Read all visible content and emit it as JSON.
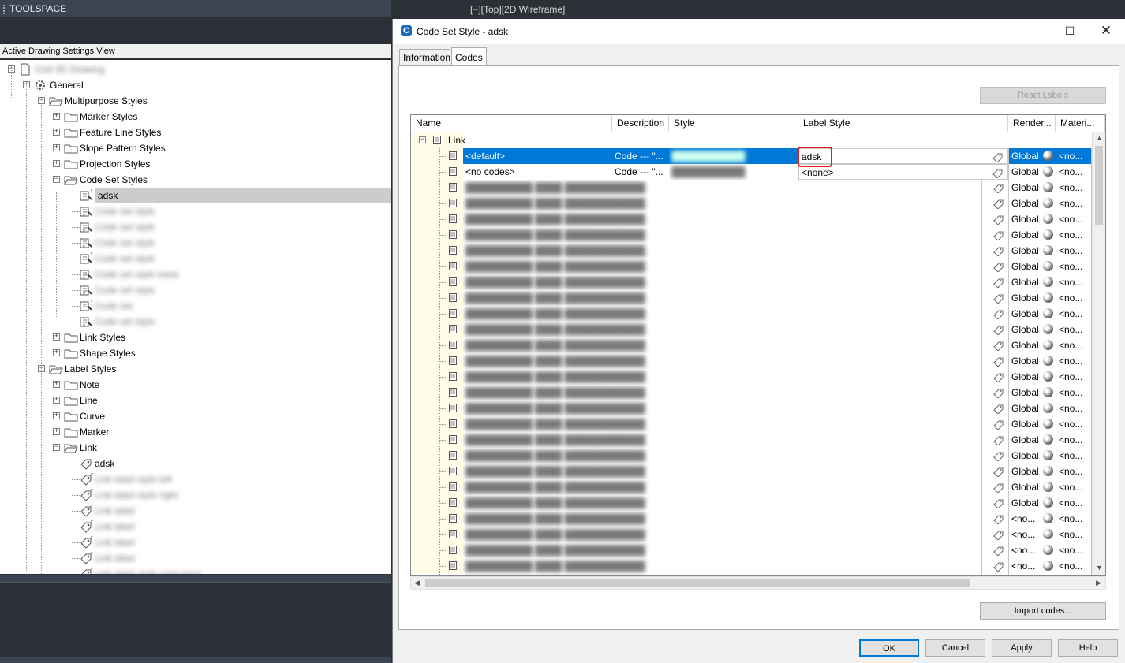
{
  "toolspace": {
    "title": "TOOLSPACE",
    "view_header": "Active Drawing Settings View",
    "tree": [
      {
        "label": "Civil 3D Drawing",
        "level": 0,
        "exp": "-",
        "icon": "drawing",
        "blur": true
      },
      {
        "label": "General",
        "level": 1,
        "exp": "-",
        "icon": "gear"
      },
      {
        "label": "Multipurpose Styles",
        "level": 2,
        "exp": "-",
        "icon": "folder-open"
      },
      {
        "label": "Marker Styles",
        "level": 3,
        "exp": "+",
        "icon": "folder"
      },
      {
        "label": "Feature Line Styles",
        "level": 3,
        "exp": "+",
        "icon": "folder"
      },
      {
        "label": "Slope Pattern Styles",
        "level": 3,
        "exp": "+",
        "icon": "folder"
      },
      {
        "label": "Projection Styles",
        "level": 3,
        "exp": "+",
        "icon": "folder"
      },
      {
        "label": "Code Set Styles",
        "level": 3,
        "exp": "-",
        "icon": "folder-open"
      },
      {
        "label": "adsk",
        "level": 4,
        "exp": "",
        "icon": "style-new",
        "selected": true
      },
      {
        "label": "Code set style",
        "level": 4,
        "exp": "",
        "icon": "style",
        "blur": true
      },
      {
        "label": "Code set style",
        "level": 4,
        "exp": "",
        "icon": "style",
        "blur": true
      },
      {
        "label": "Code set style",
        "level": 4,
        "exp": "",
        "icon": "style",
        "blur": true
      },
      {
        "label": "Code set style",
        "level": 4,
        "exp": "",
        "icon": "style-new",
        "blur": true
      },
      {
        "label": "Code set style extra",
        "level": 4,
        "exp": "",
        "icon": "style",
        "blur": true
      },
      {
        "label": "Code set style",
        "level": 4,
        "exp": "",
        "icon": "style",
        "blur": true
      },
      {
        "label": "Code set",
        "level": 4,
        "exp": "",
        "icon": "style-new",
        "blur": true
      },
      {
        "label": "Code set style",
        "level": 4,
        "exp": "",
        "icon": "style",
        "blur": true
      },
      {
        "label": "Link Styles",
        "level": 3,
        "exp": "+",
        "icon": "folder"
      },
      {
        "label": "Shape Styles",
        "level": 3,
        "exp": "+",
        "icon": "folder"
      },
      {
        "label": "Label Styles",
        "level": 2,
        "exp": "-",
        "icon": "folder-open"
      },
      {
        "label": "Note",
        "level": 3,
        "exp": "+",
        "icon": "folder"
      },
      {
        "label": "Line",
        "level": 3,
        "exp": "+",
        "icon": "folder"
      },
      {
        "label": "Curve",
        "level": 3,
        "exp": "+",
        "icon": "folder"
      },
      {
        "label": "Marker",
        "level": 3,
        "exp": "+",
        "icon": "folder"
      },
      {
        "label": "Link",
        "level": 3,
        "exp": "-",
        "icon": "folder-open"
      },
      {
        "label": "adsk",
        "level": 4,
        "exp": "",
        "icon": "label"
      },
      {
        "label": "Link label style left",
        "level": 4,
        "exp": "",
        "icon": "label-new",
        "blur": true
      },
      {
        "label": "Link label style right",
        "level": 4,
        "exp": "",
        "icon": "label-new",
        "blur": true
      },
      {
        "label": "Link label",
        "level": 4,
        "exp": "",
        "icon": "label-new",
        "blur": true
      },
      {
        "label": "Link label",
        "level": 4,
        "exp": "",
        "icon": "label-new",
        "blur": true
      },
      {
        "label": "Link label",
        "level": 4,
        "exp": "",
        "icon": "label-new",
        "blur": true
      },
      {
        "label": "Link label",
        "level": 4,
        "exp": "",
        "icon": "label-new",
        "blur": true
      },
      {
        "label": "Link label style extra long",
        "level": 4,
        "exp": "",
        "icon": "label-new",
        "blur": true
      }
    ]
  },
  "viewport": {
    "label": "[−][Top][2D Wireframe]"
  },
  "dialog": {
    "title": "Code Set Style - adsk",
    "tabs": [
      {
        "label": "Information",
        "active": false
      },
      {
        "label": "Codes",
        "active": true
      }
    ],
    "reset_labels": "Reset Labels",
    "import_codes": "Import codes...",
    "buttons": {
      "ok": "OK",
      "cancel": "Cancel",
      "apply": "Apply",
      "help": "Help"
    },
    "columns": [
      "Name",
      "Description",
      "Style",
      "Label Style",
      "Render...",
      "Materi..."
    ],
    "group_label": "Link",
    "rows": [
      {
        "name": "<default>",
        "desc": "Code --- \"...",
        "label_style": "adsk",
        "render": "Global",
        "material": "<no...",
        "selected": true
      },
      {
        "name": "<no codes>",
        "desc": "Code --- \"...",
        "label_style": "<none>",
        "render": "Global",
        "material": "<no..."
      }
    ],
    "blurred_rows": [
      {
        "render": "Global",
        "material": "<no..."
      },
      {
        "render": "Global",
        "material": "<no..."
      },
      {
        "render": "Global",
        "material": "<no..."
      },
      {
        "render": "Global",
        "material": "<no..."
      },
      {
        "render": "Global",
        "material": "<no..."
      },
      {
        "render": "Global",
        "material": "<no..."
      },
      {
        "render": "Global",
        "material": "<no..."
      },
      {
        "render": "Global",
        "material": "<no..."
      },
      {
        "render": "Global",
        "material": "<no..."
      },
      {
        "render": "Global",
        "material": "<no..."
      },
      {
        "render": "Global",
        "material": "<no..."
      },
      {
        "render": "Global",
        "material": "<no..."
      },
      {
        "render": "Global",
        "material": "<no..."
      },
      {
        "render": "Global",
        "material": "<no..."
      },
      {
        "render": "Global",
        "material": "<no..."
      },
      {
        "render": "Global",
        "material": "<no..."
      },
      {
        "render": "Global",
        "material": "<no..."
      },
      {
        "render": "Global",
        "material": "<no..."
      },
      {
        "render": "Global",
        "material": "<no..."
      },
      {
        "render": "Global",
        "material": "<no..."
      },
      {
        "render": "Global",
        "material": "<no..."
      },
      {
        "render": "<no...",
        "material": "<no..."
      },
      {
        "render": "<no...",
        "material": "<no..."
      },
      {
        "render": "<no...",
        "material": "<no..."
      },
      {
        "render": "<no...",
        "material": "<no..."
      },
      {
        "render": "<no...",
        "material": "<no..."
      }
    ],
    "accent": "#0078d7",
    "highlight": "#e02020"
  }
}
